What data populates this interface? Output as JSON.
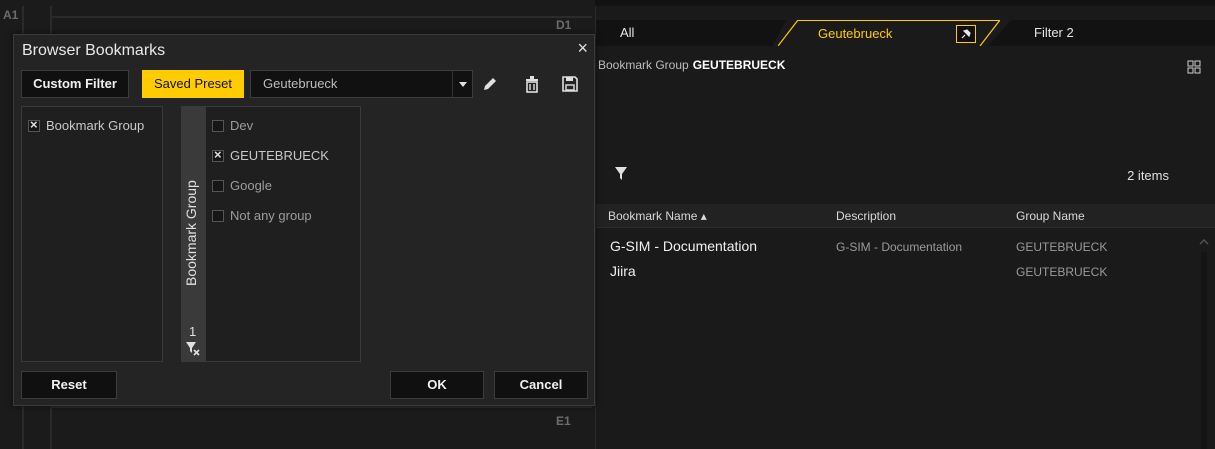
{
  "workspace": {
    "cells": [
      "A1",
      "D1",
      "E1"
    ]
  },
  "dialog": {
    "title": "Browser Bookmarks",
    "close_label": "×",
    "custom_filter_label": "Custom Filter",
    "saved_preset_label": "Saved Preset",
    "preset_value": "Geutebrueck",
    "field_list": [
      {
        "label": "Bookmark Group",
        "checked": true
      }
    ],
    "group_axis_label": "Bookmark Group",
    "group_axis_count": "1",
    "values": [
      {
        "label": "Dev",
        "checked": false
      },
      {
        "label": "GEUTEBRUECK",
        "checked": true
      },
      {
        "label": "Google",
        "checked": false
      },
      {
        "label": "Not any group",
        "checked": false
      }
    ],
    "reset_label": "Reset",
    "ok_label": "OK",
    "cancel_label": "Cancel"
  },
  "right_panel": {
    "tabs": [
      {
        "label": "All"
      },
      {
        "label": "Geutebrueck"
      },
      {
        "label": "Filter 2"
      }
    ],
    "group_prefix": "Bookmark Group",
    "group_value": "GEUTEBRUECK",
    "items_count": "2 items",
    "columns": [
      "Bookmark Name ▴",
      "Description",
      "Group Name"
    ],
    "rows": [
      {
        "name": "G-SIM - Documentation",
        "description": "G-SIM - Documentation",
        "group": "GEUTEBRUECK"
      },
      {
        "name": "Jiira",
        "description": "",
        "group": "GEUTEBRUECK"
      }
    ]
  },
  "colors": {
    "accent": "#ffcc00",
    "background": "#1e1e1e",
    "panel": "#242424"
  }
}
